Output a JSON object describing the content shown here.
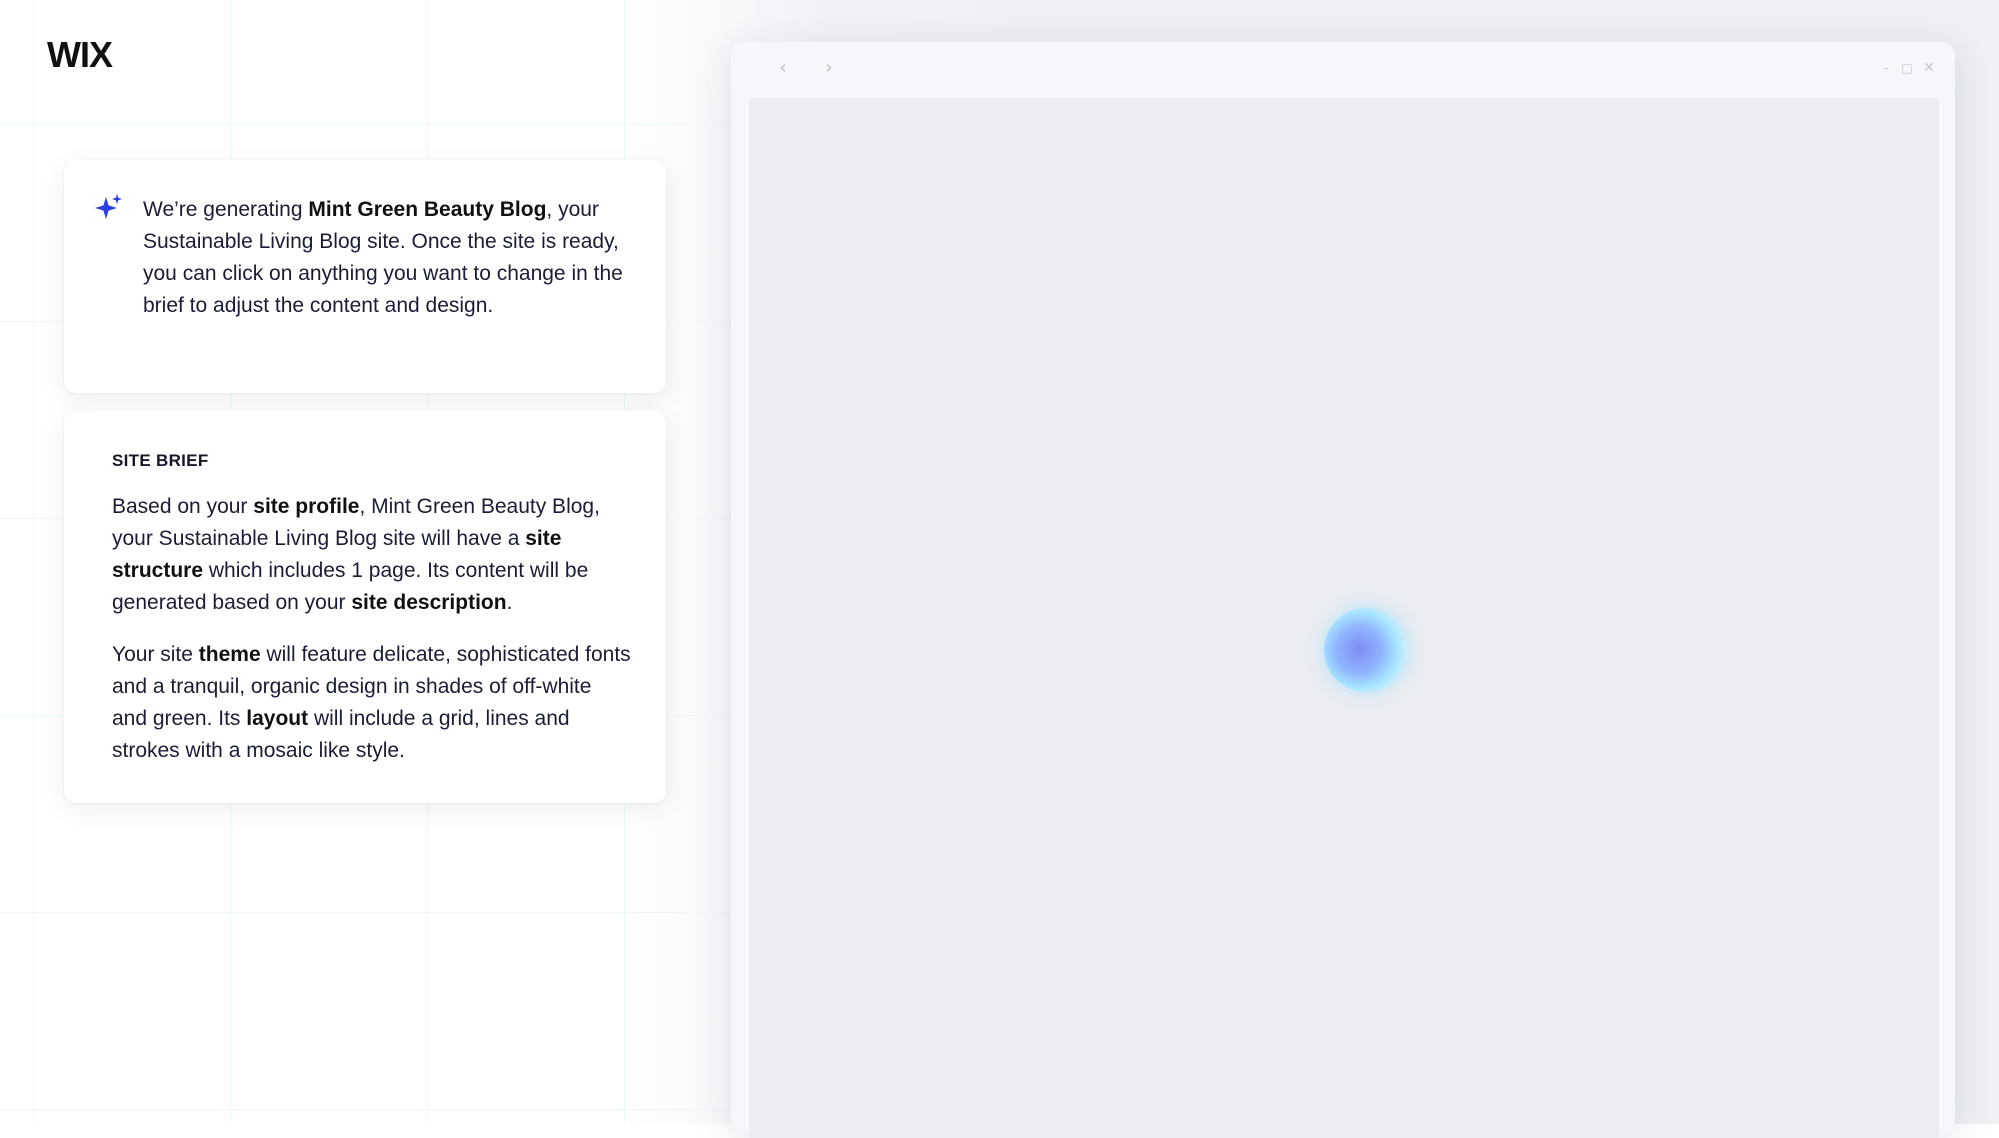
{
  "brand": {
    "logo_text": "WIX"
  },
  "generation_card": {
    "icon": "sparkle-icon",
    "icon_color": "#2b3fe0",
    "text_before": "We’re generating ",
    "site_name": "Mint Green Beauty Blog",
    "text_after": ", your Sustainable Living Blog site. Once the site is ready, you can click on anything you want to change in the brief to adjust the content and design."
  },
  "site_brief": {
    "title": "SITE BRIEF",
    "p1": {
      "t1": "Based on your ",
      "k1": "site profile",
      "t2": ", Mint Green Beauty Blog, your Sustainable Living Blog site will have a ",
      "k2": "site structure",
      "t3": " which includes 1 page. Its content will be generated based on your ",
      "k3": "site description",
      "t4": "."
    },
    "p2": {
      "t1": "Your site ",
      "k1": "theme",
      "t2": " will feature delicate, sophisticated fonts and a tranquil, organic design in shades of off-white and green. Its ",
      "k2": "layout",
      "t3": " will include a grid, lines and strokes with a mosaic like style."
    }
  },
  "browser": {
    "back_icon": "chevron-left-icon",
    "forward_icon": "chevron-right-icon",
    "back_glyph": "‹",
    "forward_glyph": "›",
    "minimize_glyph": "–",
    "maximize_glyph": "□",
    "close_glyph": "✕",
    "loading_indicator": "loading-orb"
  }
}
